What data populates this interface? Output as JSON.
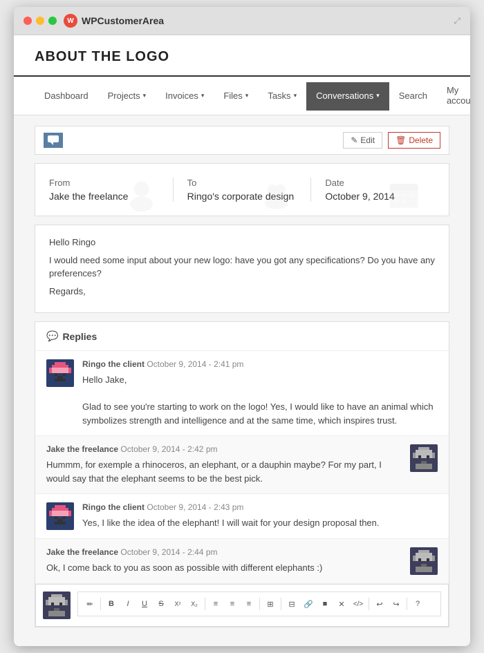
{
  "window": {
    "title": "WPCustomerArea",
    "expand_icon": "⤢"
  },
  "page": {
    "title": "ABOUT THE LOGO"
  },
  "nav": {
    "items": [
      {
        "label": "Dashboard",
        "has_caret": false,
        "active": false
      },
      {
        "label": "Projects",
        "has_caret": true,
        "active": false
      },
      {
        "label": "Invoices",
        "has_caret": true,
        "active": false
      },
      {
        "label": "Files",
        "has_caret": true,
        "active": false
      },
      {
        "label": "Tasks",
        "has_caret": true,
        "active": false
      },
      {
        "label": "Conversations",
        "has_caret": true,
        "active": true
      },
      {
        "label": "Search",
        "has_caret": false,
        "active": false
      },
      {
        "label": "My account",
        "has_caret": true,
        "active": false
      }
    ]
  },
  "toolbar": {
    "edit_label": "Edit",
    "delete_label": "Delete"
  },
  "meta": {
    "from_label": "From",
    "from_value": "Jake the freelance",
    "to_label": "To",
    "to_value": "Ringo's corporate design",
    "date_label": "Date",
    "date_value": "October 9, 2014"
  },
  "message": {
    "greeting": "Hello Ringo",
    "body": "I would need some input about your new logo: have you got any specifications? Do you have any preferences?",
    "closing": "Regards,"
  },
  "replies": {
    "section_label": "Replies",
    "items": [
      {
        "author": "Ringo the client",
        "date": "October 9, 2014 - 2:41 pm",
        "text": "Hello Jake,\n\nGlad to see you're starting to work on the logo! Yes, I would like to have an animal which symbolizes strength and intelligence and at the same time, which inspires trust.",
        "side": "left",
        "avatar_type": "ringo"
      },
      {
        "author": "Jake the freelance",
        "date": "October 9, 2014 - 2:42 pm",
        "text": "Hummm, for exemple a rhinoceros, an elephant, or a dauphin maybe? For my part, I would say that the elephant seems to be the best pick.",
        "side": "right",
        "avatar_type": "jake"
      },
      {
        "author": "Ringo the client",
        "date": "October 9, 2014 - 2:43 pm",
        "text": "Yes, I like the idea of the elephant! I will wait for your design proposal then.",
        "side": "left",
        "avatar_type": "ringo"
      },
      {
        "author": "Jake the freelance",
        "date": "October 9, 2014 - 2:44 pm",
        "text": "Ok, I come back to you as soon as possible with different elephants :)",
        "side": "right",
        "avatar_type": "jake"
      }
    ]
  },
  "editor": {
    "tools": [
      "✏",
      "B",
      "I",
      "U",
      "S",
      "X²",
      "X₂",
      "≡",
      "≡",
      "≡",
      "|",
      "⊞",
      "|",
      "⊟",
      "🔗",
      "⬛",
      "✕",
      "</>",
      "|",
      "↩",
      "↪",
      "?"
    ]
  }
}
